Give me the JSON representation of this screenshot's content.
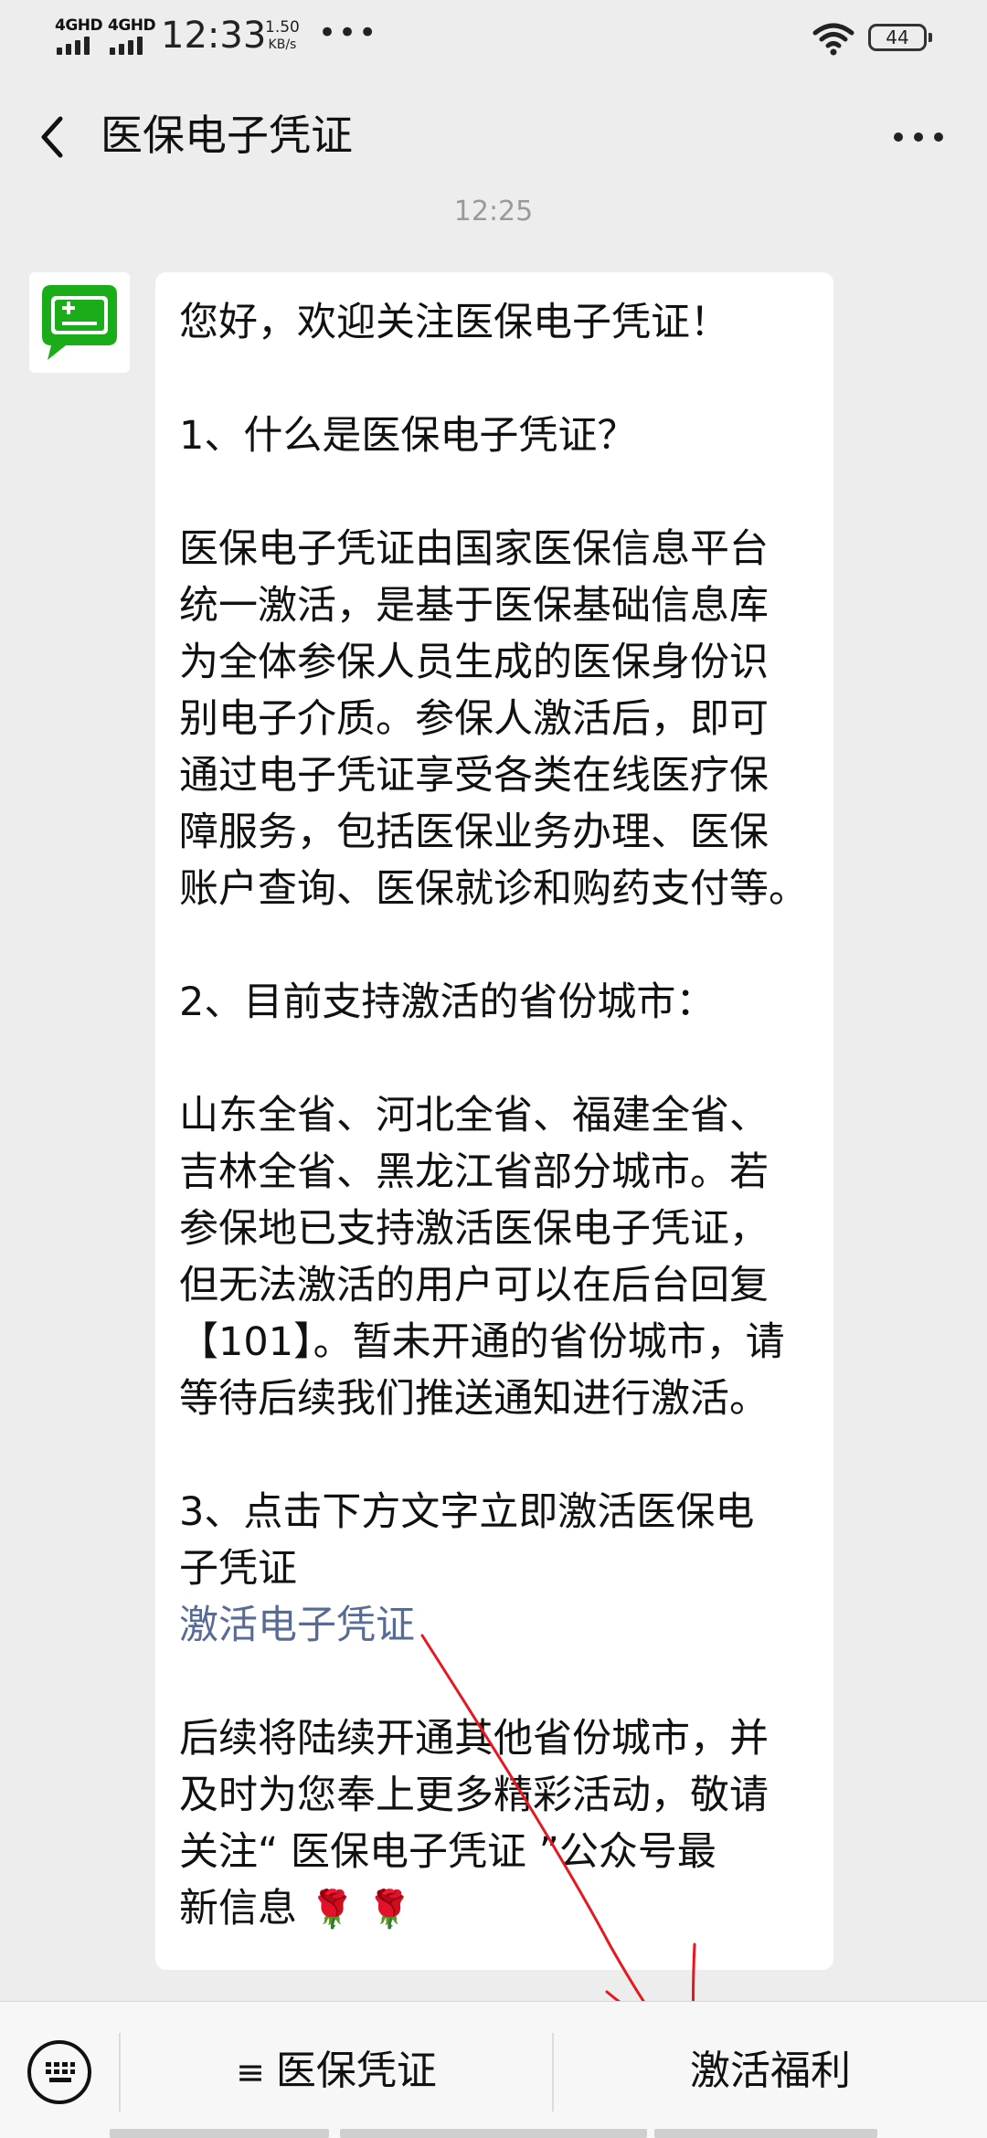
{
  "status_bar": {
    "network_1": "4GHD",
    "network_2": "4GHD",
    "time": "12:33",
    "speed_value": "1.50",
    "speed_unit": "KB/s",
    "more_indicator": "•••",
    "battery": "44"
  },
  "header": {
    "title": "医保电子凭证",
    "back_icon": "chevron-left-icon",
    "more_icon": "more-dots-icon"
  },
  "chat": {
    "timestamp": "12:25",
    "avatar_icon": "insurance-card-chat-icon",
    "message_lines": [
      "您好，欢迎关注医保电子凭证！",
      "1、什么是医保电子凭证？",
      "医保电子凭证由国家医保信息平台",
      "统一激活，是基于医保基础信息库",
      "为全体参保人员生成的医保身份识",
      "别电子介质。参保人激活后，即可",
      "通过电子凭证享受各类在线医疗保",
      "障服务，包括医保业务办理、医保",
      "账户查询、医保就诊和购药支付等。",
      "2、目前支持激活的省份城市：",
      "山东全省、河北全省、福建全省、",
      "吉林全省、黑龙江省部分城市。若",
      "参保地已支持激活医保电子凭证，",
      "但无法激活的用户可以在后台回复",
      "【101】。暂未开通的省份城市，请",
      "等待后续我们推送通知进行激活。",
      "3、点击下方文字立即激活医保电",
      "子凭证",
      "后续将陆续开通其他省份城市，并",
      "及时为您奉上更多精彩活动，敬请",
      "关注“ 医保电子凭证 ”公众号最",
      "新信息"
    ],
    "link_text": "激活电子凭证",
    "emoji": "🌹 🌹"
  },
  "bottom_menu": {
    "keyboard_icon": "keyboard-icon",
    "menu_glyph": "≡",
    "menu_1": "医保凭证",
    "menu_2": "激活福利"
  },
  "colors": {
    "background": "#ededed",
    "bubble": "#ffffff",
    "link": "#576b95",
    "avatar_green": "#1aad19",
    "annotation_red": "#e8161e"
  }
}
